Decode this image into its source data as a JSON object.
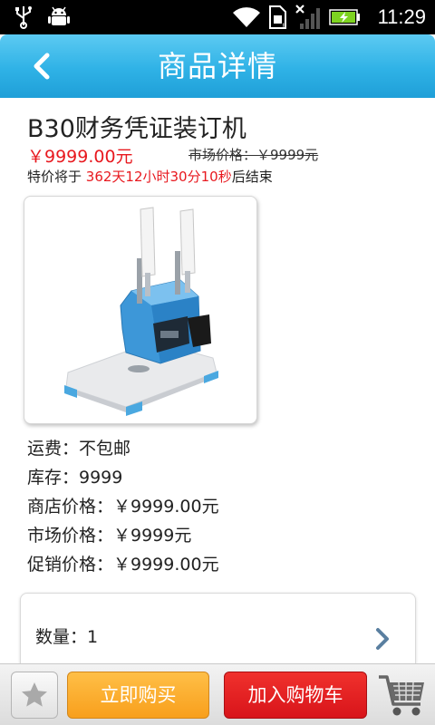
{
  "status_bar": {
    "time": "11:29",
    "icons": [
      "usb-icon",
      "android-debug-icon",
      "wifi-icon",
      "sim-icon",
      "signal-icon",
      "battery-charging-icon"
    ]
  },
  "header": {
    "title": "商品详情",
    "back_icon": "chevron-left-icon"
  },
  "product": {
    "name": "B30财务凭证装订机",
    "current_price": "￥9999.00元",
    "market_price_strike": "市场价格：￥9999元",
    "countdown_prefix": "特价将于",
    "countdown_value": "362天12小时30分10秒",
    "countdown_suffix": "后结束",
    "image_icon": "binding-machine-image"
  },
  "info": {
    "shipping": "运费：不包邮",
    "stock": "库存：9999",
    "store_price": "商店价格：￥9999.00元",
    "market_price": "市场价格：￥9999元",
    "promo_price": "促销价格：￥9999.00元"
  },
  "quantity": {
    "label": "数量：1",
    "chevron_icon": "chevron-right-icon"
  },
  "toolbar": {
    "favorite_icon": "star-icon",
    "buy_now_label": "立即购买",
    "add_to_cart_label": "加入购物车",
    "cart_icon": "shopping-cart-icon"
  },
  "colors": {
    "header_blue": "#2fb2e6",
    "price_red": "#e8191f",
    "buy_orange": "#f89f1c",
    "cart_red": "#d8141a"
  }
}
